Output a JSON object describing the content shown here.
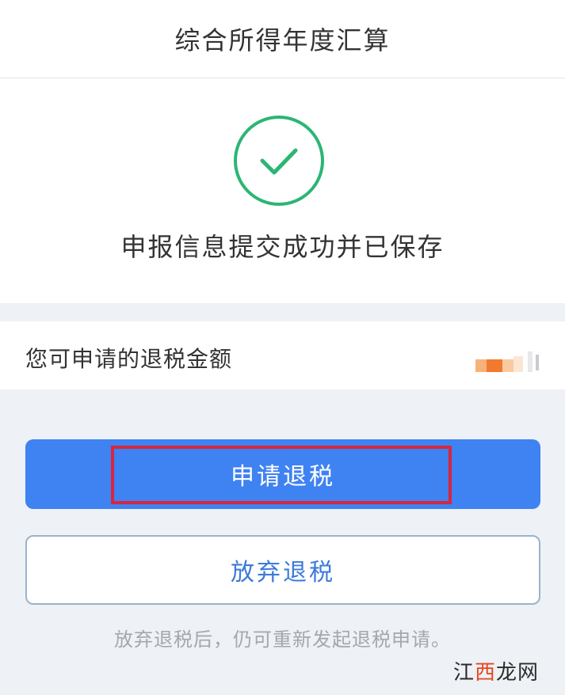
{
  "header": {
    "title": "综合所得年度汇算"
  },
  "success": {
    "message": "申报信息提交成功并已保存"
  },
  "refund": {
    "label": "您可申请的退税金额"
  },
  "actions": {
    "apply_label": "申请退税",
    "abandon_label": "放弃退税",
    "hint": "放弃退税后，仍可重新发起退税申请。"
  },
  "watermark": {
    "text_1": "江",
    "text_2": "西",
    "text_3": "龙网"
  },
  "colors": {
    "primary": "#3f82f2",
    "success_green": "#2bb673",
    "highlight_red": "#d7263d",
    "amount_blur": "#f59a4e"
  },
  "icons": {
    "status": "check-circle-icon"
  }
}
